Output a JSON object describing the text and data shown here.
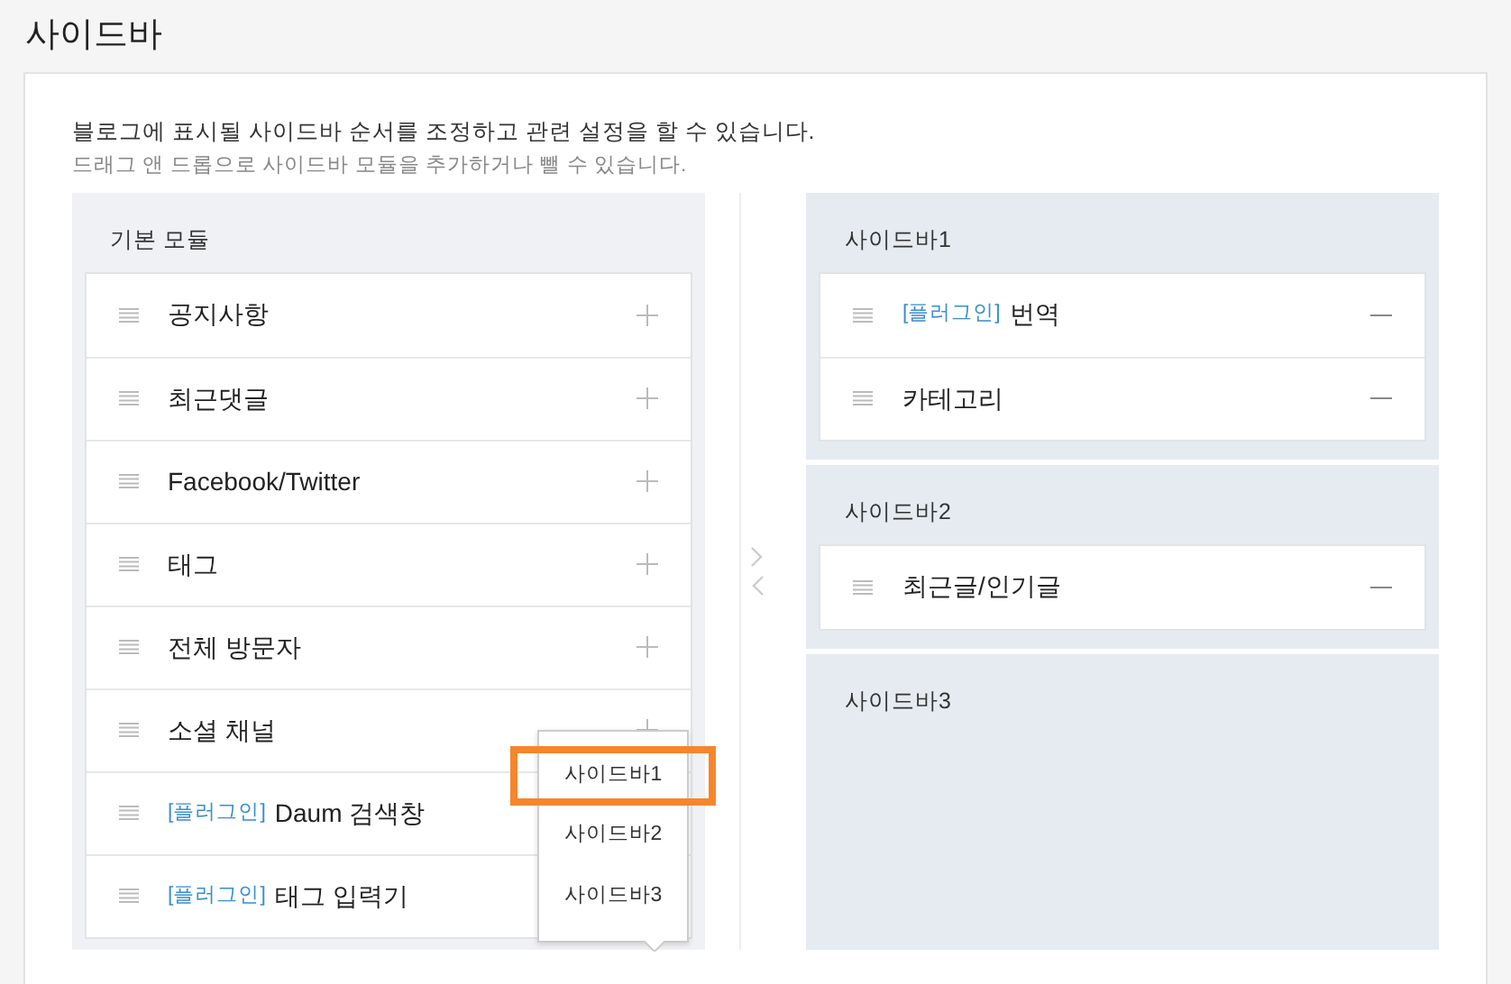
{
  "page_title": "사이드바",
  "description": "블로그에 표시될 사이드바 순서를 조정하고 관련 설정을 할 수 있습니다.",
  "hint": "드래그 앤 드롭으로 사이드바 모듈을 추가하거나 뺄 수 있습니다.",
  "basic_modules": {
    "title": "기본 모듈",
    "items": [
      {
        "name": "공지사항"
      },
      {
        "name": "최근댓글"
      },
      {
        "name": "Facebook/Twitter"
      },
      {
        "name": "태그"
      },
      {
        "name": "전체 방문자"
      },
      {
        "name": "소셜 채널"
      },
      {
        "tag": "[플러그인]",
        "name": "Daum 검색창"
      },
      {
        "tag": "[플러그인]",
        "name": "태그 입력기",
        "menu_open": true
      }
    ]
  },
  "add_menu": [
    {
      "label": "사이드바1",
      "selected": true
    },
    {
      "label": "사이드바2",
      "selected": false
    },
    {
      "label": "사이드바3",
      "selected": false
    }
  ],
  "sidebars": [
    {
      "title": "사이드바1",
      "items": [
        {
          "tag": "[플러그인]",
          "name": "번역"
        },
        {
          "name": "카테고리"
        }
      ]
    },
    {
      "title": "사이드바2",
      "items": [
        {
          "name": "최근글/인기글"
        }
      ]
    },
    {
      "title": "사이드바3"
    }
  ]
}
